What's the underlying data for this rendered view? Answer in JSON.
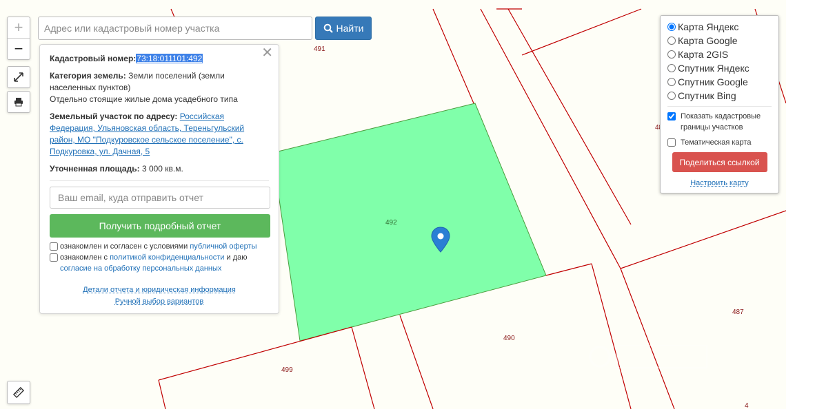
{
  "search": {
    "placeholder": "Адрес или кадастровый номер участка",
    "button_label": "Найти"
  },
  "zoom": {
    "in_label": "+",
    "out_label": "−"
  },
  "info": {
    "cadastral_label": "Кадастровый номер:",
    "cadastral_number": "73:18:011101:492",
    "category_label": "Категория земель:",
    "category_value": "Земли поселений (земли населенных пунктов)",
    "category_use": "Отдельно стоящие жилые дома усадебного типа",
    "address_label": "Земельный участок по адресу:",
    "address_value": "Российская Федерация, Ульяновская область, Тереньгульский район, МО \"Подкуровское сельское поселение\", с. Подкуровка, ул. Дачная, 5",
    "area_label": "Уточненная площадь:",
    "area_value": "3 000 кв.м.",
    "email_placeholder": "Ваш email, куда отправить отчет",
    "report_button": "Получить подробный отчет",
    "consent1_text": "ознакомлен и согласен с условиями ",
    "consent1_link": "публичной оферты",
    "consent2_text_a": "ознакомлен с ",
    "consent2_link_a": "политикой конфиденциальности",
    "consent2_text_b": " и даю ",
    "consent2_link_b": "согласие на обработку персональных данных",
    "details_link": "Детали отчета и юридическая информация",
    "manual_link": "Ручной выбор вариантов"
  },
  "layers": {
    "options": [
      {
        "label": "Карта Яндекс",
        "checked": true
      },
      {
        "label": "Карта Google",
        "checked": false
      },
      {
        "label": "Карта 2GIS",
        "checked": false
      },
      {
        "label": "Спутник Яндекс",
        "checked": false
      },
      {
        "label": "Спутник Google",
        "checked": false
      },
      {
        "label": "Спутник Bing",
        "checked": false
      }
    ],
    "show_borders_label": "Показать кадастровые границы участков",
    "show_borders_checked": true,
    "thematic_label": "Тематическая карта",
    "thematic_checked": false,
    "share_button": "Поделиться ссылкой",
    "configure_link": "Настроить карту"
  },
  "parcels": {
    "p491": "491",
    "p492": "492",
    "p490": "490",
    "p499": "499",
    "p487": "487",
    "p4": "4",
    "p48": "48"
  },
  "colors": {
    "selected_parcel": "#80ffaa",
    "parcel_border": "#c00000",
    "marker": "#2a7fd4"
  }
}
